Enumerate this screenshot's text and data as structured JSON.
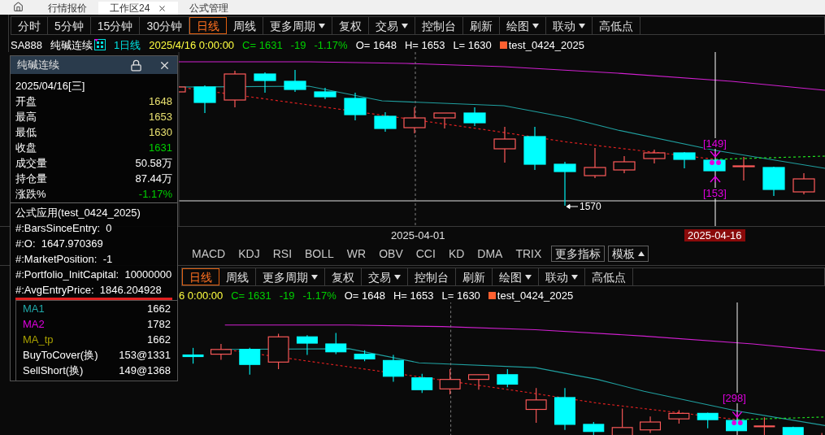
{
  "tabs": [
    {
      "label": "行情报价",
      "selected": false
    },
    {
      "label": "工作区24",
      "selected": true
    },
    {
      "label": "公式管理",
      "selected": false
    }
  ],
  "toolbar": [
    {
      "label": "分时",
      "selected": false,
      "dropdown": false
    },
    {
      "label": "5分钟",
      "selected": false,
      "dropdown": false
    },
    {
      "label": "15分钟",
      "selected": false,
      "dropdown": false
    },
    {
      "label": "30分钟",
      "selected": false,
      "dropdown": false
    },
    {
      "label": "日线",
      "selected": true,
      "dropdown": false
    },
    {
      "label": "周线",
      "selected": false,
      "dropdown": false
    },
    {
      "label": "更多周期",
      "selected": false,
      "dropdown": true
    },
    {
      "label": "复权",
      "selected": false,
      "dropdown": false
    },
    {
      "label": "交易",
      "selected": false,
      "dropdown": true
    },
    {
      "label": "控制台",
      "selected": false,
      "dropdown": false
    },
    {
      "label": "刷新",
      "selected": false,
      "dropdown": false
    },
    {
      "label": "绘图",
      "selected": false,
      "dropdown": true
    },
    {
      "label": "联动",
      "selected": false,
      "dropdown": true
    },
    {
      "label": "高低点",
      "selected": false,
      "dropdown": false
    }
  ],
  "quote_line": {
    "symbol": "SA888",
    "name": "纯碱连续",
    "period": "1日线",
    "datetime": "2025/4/16 0:00:00",
    "close": "C= 1631",
    "change": "-19",
    "change_pct": "-1.17%",
    "open": "O= 1648",
    "high": "H= 1653",
    "low": "L= 1630",
    "formula": "test_0424_2025"
  },
  "chart_labels": [
    {
      "text": "[149]",
      "kind": "signal"
    },
    {
      "text": "[153]",
      "kind": "signal"
    },
    {
      "text": "1570",
      "kind": "low"
    }
  ],
  "x_axis": [
    {
      "label": "2025-04-01",
      "selected": false
    },
    {
      "label": "2025-04-16",
      "selected": true
    }
  ],
  "indicator_tabs": [
    {
      "label": "MACD",
      "kind": "plain"
    },
    {
      "label": "KDJ",
      "kind": "plain"
    },
    {
      "label": "RSI",
      "kind": "plain"
    },
    {
      "label": "BOLL",
      "kind": "plain"
    },
    {
      "label": "WR",
      "kind": "plain"
    },
    {
      "label": "OBV",
      "kind": "plain"
    },
    {
      "label": "CCI",
      "kind": "plain"
    },
    {
      "label": "KD",
      "kind": "plain"
    },
    {
      "label": "DMA",
      "kind": "plain"
    },
    {
      "label": "TRIX",
      "kind": "plain"
    },
    {
      "label": "更多指标",
      "kind": "button"
    },
    {
      "label": "模板",
      "kind": "popup"
    }
  ],
  "lower_pane": {
    "toolbar": [
      {
        "label": "日线",
        "selected": true,
        "dropdown": false
      },
      {
        "label": "周线",
        "selected": false,
        "dropdown": false
      },
      {
        "label": "更多周期",
        "selected": false,
        "dropdown": true
      },
      {
        "label": "复权",
        "selected": false,
        "dropdown": false
      },
      {
        "label": "交易",
        "selected": false,
        "dropdown": true
      },
      {
        "label": "控制台",
        "selected": false,
        "dropdown": false
      },
      {
        "label": "刷新",
        "selected": false,
        "dropdown": false
      },
      {
        "label": "绘图",
        "selected": false,
        "dropdown": true
      },
      {
        "label": "联动",
        "selected": false,
        "dropdown": true
      },
      {
        "label": "高低点",
        "selected": false,
        "dropdown": false
      }
    ],
    "quote_line": {
      "datetime": "6 0:00:00",
      "close": "C= 1631",
      "change": "-19",
      "change_pct": "-1.17%",
      "open": "O= 1648",
      "high": "H= 1653",
      "low": "L= 1630",
      "formula": "test_0424_2025"
    },
    "chart_labels": [
      {
        "text": "[298]",
        "kind": "signal"
      }
    ]
  },
  "info_panel": {
    "title": "纯碱连续",
    "date": "2025/04/16[三]",
    "rows": [
      {
        "label": "开盘",
        "value": "1648",
        "color": "#e8e070"
      },
      {
        "label": "最高",
        "value": "1653",
        "color": "#e8e070"
      },
      {
        "label": "最低",
        "value": "1630",
        "color": "#e8e070"
      },
      {
        "label": "收盘",
        "value": "1631",
        "color": "#00d000"
      },
      {
        "label": "成交量",
        "value": "50.58万",
        "color": "#ffffff"
      },
      {
        "label": "持仓量",
        "value": "87.44万",
        "color": "#ffffff"
      },
      {
        "label": "涨跌%",
        "value": "-1.17%",
        "color": "#00d000"
      }
    ],
    "formula_title": "公式应用(test_0424_2025)",
    "formula_lines": [
      {
        "text": "#:BarsSinceEntry:  0",
        "underlined": false
      },
      {
        "text": "#:O:  1647.970369",
        "underlined": false
      },
      {
        "text": "#:MarketPosition:  -1",
        "underlined": false
      },
      {
        "text": "#:Portfolio_InitCapital:  10000000",
        "underlined": false
      },
      {
        "text": "#:AvgEntryPrice:  1846.204928",
        "underlined": true
      }
    ],
    "legend": [
      {
        "label": "MA1",
        "value": "1662",
        "color": "#20a8a8"
      },
      {
        "label": "MA2",
        "value": "1782",
        "color": "#e000e0"
      },
      {
        "label": "MA_tp",
        "value": "1662",
        "color": "#a8a000"
      },
      {
        "label": "BuyToCover(换)",
        "value": "153@1331",
        "color": "#ffffff"
      },
      {
        "label": "SellShort(换)",
        "value": "149@1368",
        "color": "#ffffff"
      }
    ]
  }
}
